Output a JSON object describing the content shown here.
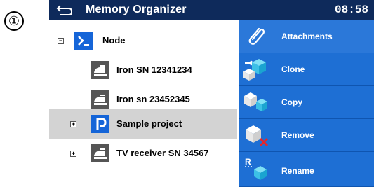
{
  "step_marker": "①",
  "header": {
    "title": "Memory Organizer",
    "time": "08:58"
  },
  "tree": {
    "rows": [
      {
        "label": "Node",
        "expander": "−",
        "icon": "console-icon"
      },
      {
        "label": "Iron SN 12341234",
        "expander": "",
        "icon": "iron-icon"
      },
      {
        "label": "Iron sn 23452345",
        "expander": "",
        "icon": "iron-icon"
      },
      {
        "label": "Sample project",
        "expander": "+",
        "icon": "project-icon",
        "selected": true
      },
      {
        "label": "TV receiver SN 34567",
        "expander": "+",
        "icon": "iron-icon"
      }
    ]
  },
  "menu": {
    "items": [
      {
        "label": "Attachments",
        "icon": "paperclip-icon"
      },
      {
        "label": "Clone",
        "icon": "clone-icon"
      },
      {
        "label": "Copy",
        "icon": "copy-icon"
      },
      {
        "label": "Remove",
        "icon": "remove-icon"
      },
      {
        "label": "Rename",
        "icon": "rename-icon",
        "icon_text": "R"
      }
    ]
  },
  "colors": {
    "header_bg": "#0e2a5b",
    "menu_bg": "#1e6fd4",
    "selected_row": "#d3d3d3",
    "cube": "#5fd3f0"
  }
}
